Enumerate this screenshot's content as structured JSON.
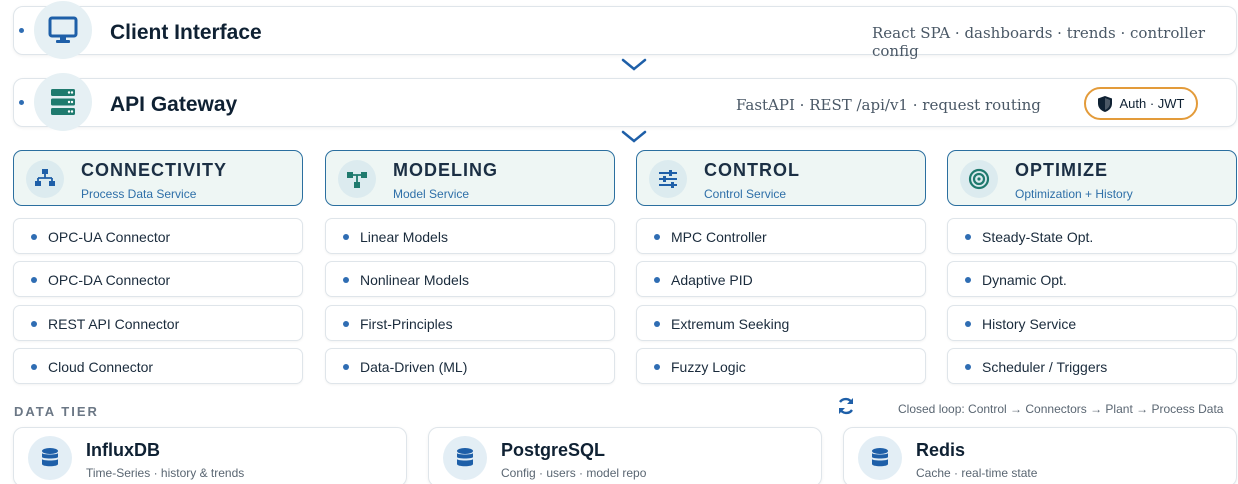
{
  "client": {
    "title": "Client Interface",
    "desc": "React SPA · dashboards · trends · controller config",
    "icon": "monitor-icon"
  },
  "gateway": {
    "title": "API Gateway",
    "desc": "FastAPI · REST /api/v1 · request routing",
    "icon": "server-icon",
    "auth_label": "Auth · JWT"
  },
  "columns": [
    {
      "title": "CONNECTIVITY",
      "subtitle": "Process Data Service",
      "icon": "network-icon",
      "items": [
        "OPC-UA Connector",
        "OPC-DA Connector",
        "REST API Connector",
        "Cloud Connector"
      ]
    },
    {
      "title": "MODELING",
      "subtitle": "Model Service",
      "icon": "flow-icon",
      "items": [
        "Linear Models",
        "Nonlinear Models",
        "First-Principles",
        "Data-Driven (ML)"
      ]
    },
    {
      "title": "CONTROL",
      "subtitle": "Control Service",
      "icon": "sliders-icon",
      "items": [
        "MPC Controller",
        "Adaptive PID",
        "Extremum Seeking",
        "Fuzzy Logic"
      ]
    },
    {
      "title": "OPTIMIZE",
      "subtitle": "Optimization + History",
      "icon": "target-icon",
      "items": [
        "Steady-State Opt.",
        "Dynamic Opt.",
        "History Service",
        "Scheduler / Triggers"
      ]
    }
  ],
  "data_tier": {
    "label": "DATA TIER",
    "loop_note": "Closed loop: Control → Connectors → Plant → Process Data",
    "stores": [
      {
        "title": "InfluxDB",
        "subtitle": "Time-Series · history & trends"
      },
      {
        "title": "PostgreSQL",
        "subtitle": "Config · users · model repo"
      },
      {
        "title": "Redis",
        "subtitle": "Cache · real-time state"
      }
    ]
  },
  "colors": {
    "accent_teal": "#1f7a6e",
    "accent_blue": "#2b6f9f",
    "auth_border": "#e39b3a"
  }
}
